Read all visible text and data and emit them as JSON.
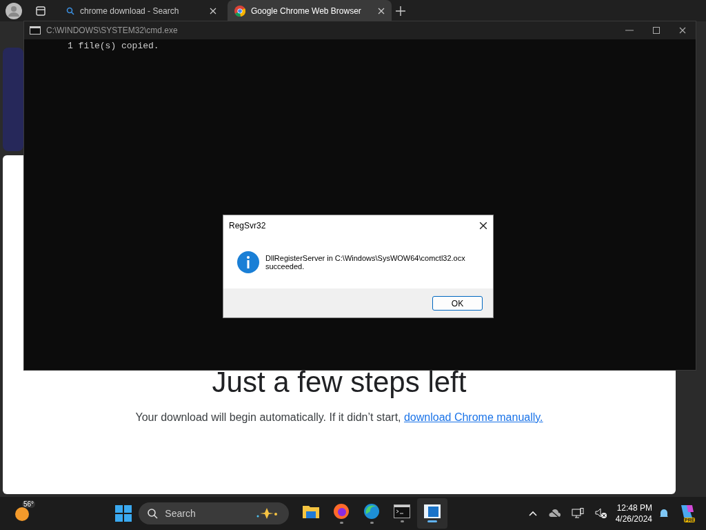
{
  "browser": {
    "tabs": [
      {
        "title": "chrome download - Search",
        "kind": "search",
        "selected": false
      },
      {
        "title": "Google Chrome Web Browser",
        "kind": "chrome",
        "selected": true
      }
    ]
  },
  "page": {
    "heading": "Just a few steps left",
    "text": "Your download will begin automatically. If it didn’t start, ",
    "link": "download Chrome manually."
  },
  "console": {
    "title": "C:\\WINDOWS\\SYSTEM32\\cmd.exe",
    "lines": [
      "1 file(s) copied."
    ]
  },
  "dialog": {
    "title": "RegSvr32",
    "message_lines": [
      "DllRegisterServer in C:\\Windows\\SysWOW64\\comctl32.ocx",
      "succeeded."
    ],
    "button": "OK"
  },
  "taskbar": {
    "weather": "56°",
    "search": {
      "placeholder": "Search"
    },
    "apps": [
      {
        "kind": "folder",
        "running": false,
        "active": false
      },
      {
        "kind": "firefox",
        "running": true,
        "active": false
      },
      {
        "kind": "edge",
        "running": true,
        "active": false
      },
      {
        "kind": "terminal",
        "running": true,
        "active": false
      },
      {
        "kind": "window",
        "running": true,
        "active": true
      }
    ],
    "time": "12:48 PM",
    "date": "4/26/2024",
    "copilot_badge": "PRE"
  }
}
